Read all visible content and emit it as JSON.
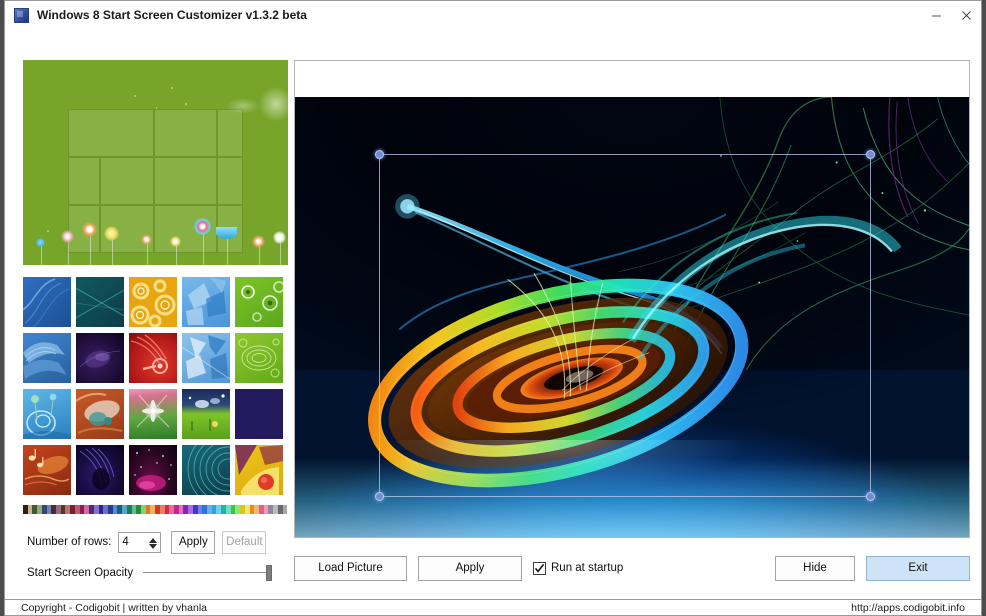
{
  "window": {
    "title": "Windows 8 Start Screen Customizer v1.3.2 beta",
    "app_icon": "app-tiles-icon",
    "controls": {
      "minimize": "minimize-icon",
      "close": "close-icon"
    }
  },
  "left_panel": {
    "start_preview": {
      "name": "start-screen-preview",
      "background_color": "#76a52a",
      "tile_color": "rgba(255,255,255,0.13)"
    },
    "thumbnails": {
      "label": "wallpaper-thumbnails",
      "columns": 5,
      "rows": 4,
      "items": [
        {
          "id": "thumb-1",
          "name": "blue-curve-lines"
        },
        {
          "id": "thumb-2",
          "name": "teal-crossing-lines"
        },
        {
          "id": "thumb-3",
          "name": "gold-swirl-pattern"
        },
        {
          "id": "thumb-4",
          "name": "light-blue-origami"
        },
        {
          "id": "thumb-5",
          "name": "green-bubbles"
        },
        {
          "id": "thumb-6",
          "name": "blue-wave-ridges"
        },
        {
          "id": "thumb-7",
          "name": "dark-purple-smoke"
        },
        {
          "id": "thumb-8",
          "name": "red-feather-swirl"
        },
        {
          "id": "thumb-9",
          "name": "blue-geometric-shards"
        },
        {
          "id": "thumb-10",
          "name": "green-paisley-lace"
        },
        {
          "id": "thumb-11",
          "name": "blue-flower-meadow"
        },
        {
          "id": "thumb-12",
          "name": "orange-abstract-fish"
        },
        {
          "id": "thumb-13",
          "name": "pink-floral-bloom"
        },
        {
          "id": "thumb-14",
          "name": "green-night-landscape"
        },
        {
          "id": "thumb-15",
          "name": "solid-dark-indigo"
        },
        {
          "id": "thumb-16",
          "name": "orange-music-notes"
        },
        {
          "id": "thumb-17",
          "name": "purple-fern-leaf"
        },
        {
          "id": "thumb-18",
          "name": "magenta-starfield"
        },
        {
          "id": "thumb-19",
          "name": "teal-concentric-arcs"
        },
        {
          "id": "thumb-20",
          "name": "yellow-bird-fruit"
        }
      ]
    },
    "palette": {
      "label": "accent-color-palette",
      "colors": [
        "#2b1f18",
        "#c8b48a",
        "#3f5a2e",
        "#8fae6d",
        "#2e4a7a",
        "#6d85b8",
        "#4a2c38",
        "#9a6b7d",
        "#5a3030",
        "#b07a6a",
        "#7a1f2e",
        "#c05a6a",
        "#8a1f52",
        "#d46ba0",
        "#4a2a7a",
        "#8f6bd4",
        "#2e2a8a",
        "#6f6bd8",
        "#1f3f8a",
        "#5a86d4",
        "#18607a",
        "#5aa8c0",
        "#1f7a5a",
        "#5ac09a",
        "#2f8a2f",
        "#7ad47a",
        "#e07a18",
        "#f5b05a",
        "#d43a28",
        "#f07a6a",
        "#d42850",
        "#f06a90",
        "#c02890",
        "#e86ac0",
        "#7a28c0",
        "#b06ae8",
        "#3a3ad4",
        "#7a7af0",
        "#2878d4",
        "#6aaaf0",
        "#28a8d4",
        "#6ad0f0",
        "#18b898",
        "#6ae0c8",
        "#3ac838",
        "#8ae878",
        "#d4c818",
        "#f0e86a",
        "#e88a18",
        "#f0b86a",
        "#e85a8a",
        "#f09ab8",
        "#8a8a9a",
        "#b8b8c8",
        "#6a6a6a",
        "#a8a8a8"
      ]
    },
    "rows_control": {
      "label": "Number of rows:",
      "value": "4",
      "apply_label": "Apply",
      "default_label": "Default",
      "default_disabled": true
    },
    "opacity_control": {
      "label": "Start Screen Opacity",
      "value": 100,
      "min": 0,
      "max": 100
    }
  },
  "right_panel": {
    "preview": {
      "name": "wallpaper-preview",
      "image_description": "rainbow-spiral-fractal-on-blue-gradient",
      "crop_selection": {
        "name": "crop-selection-rectangle",
        "handles": [
          "top-left",
          "top-right",
          "bottom-left",
          "bottom-right"
        ],
        "handle_color": "#6f8fd0"
      }
    },
    "actions": {
      "load_picture_label": "Load Picture",
      "apply_label": "Apply",
      "run_at_startup_label": "Run at startup",
      "run_at_startup_checked": true,
      "hide_label": "Hide",
      "exit_label": "Exit"
    }
  },
  "status_bar": {
    "left": "Copyright - Codigobit | written by vhanla",
    "right": "http://apps.codigobit.info"
  }
}
